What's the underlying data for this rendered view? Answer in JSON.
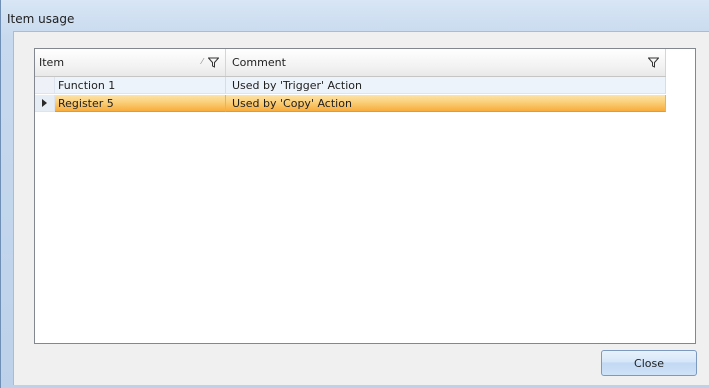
{
  "window": {
    "title": "Item usage"
  },
  "grid": {
    "columns": [
      {
        "key": "item",
        "label": "Item",
        "sort_icon": "sort-ascending-icon",
        "filter_icon": "filter-icon"
      },
      {
        "key": "comment",
        "label": "Comment",
        "filter_icon": "filter-icon"
      }
    ],
    "rows": [
      {
        "item": "Function 1",
        "comment": "Used by 'Trigger' Action",
        "selected": false
      },
      {
        "item": "Register 5",
        "comment": "Used by 'Copy' Action",
        "selected": true
      }
    ],
    "selection_color": "#f8ad3c"
  },
  "buttons": {
    "close_label": "Close"
  }
}
